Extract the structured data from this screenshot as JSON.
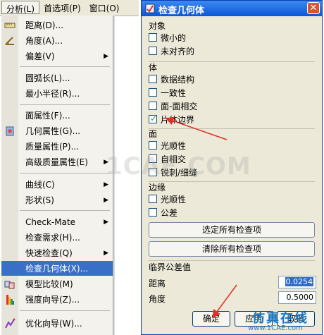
{
  "menubar": {
    "items": [
      {
        "label": "分析(L)",
        "active": true
      },
      {
        "label": "首选项(P)"
      },
      {
        "label": "窗口(O)"
      }
    ]
  },
  "menu": {
    "items": [
      {
        "label": "距离(D)...",
        "icon": "ruler-icon"
      },
      {
        "label": "角度(A)...",
        "icon": "protractor-icon"
      },
      {
        "label": "偏差(V)",
        "submenu": true
      },
      {
        "label": "圆弧长(L)..."
      },
      {
        "label": "最小半径(R)..."
      },
      {
        "label": "面属性(F)..."
      },
      {
        "label": "几何属性(G)...",
        "icon": "geometry-properties-icon"
      },
      {
        "label": "质量属性(P)..."
      },
      {
        "label": "高级质量属性(E)",
        "submenu": true
      },
      {
        "label": "曲线(C)",
        "submenu": true
      },
      {
        "label": "形状(S)",
        "submenu": true
      },
      {
        "label": "Check-Mate",
        "submenu": true
      },
      {
        "label": "检查需求(H)..."
      },
      {
        "label": "快速检查(Q)",
        "submenu": true
      },
      {
        "label": "检查几何体(X)...",
        "highlighted": true
      },
      {
        "label": "模型比较(M)",
        "icon": "model-compare-icon"
      },
      {
        "label": "强度向导(Z)...",
        "icon": "strength-wizard-icon"
      },
      {
        "label": "优化向导(W)...",
        "icon": "optimization-wizard-icon"
      }
    ]
  },
  "dialog": {
    "title": "检查几何体",
    "groups": {
      "objects": "对象",
      "body": "体",
      "face": "面",
      "edge": "边缘",
      "tolerance": "临界公差值"
    },
    "checks": {
      "tiny": {
        "label": "微小的",
        "checked": false
      },
      "misaligned": {
        "label": "未对齐的",
        "checked": false
      },
      "data_structure": {
        "label": "数据结构",
        "checked": false
      },
      "consistency": {
        "label": "一致性",
        "checked": false
      },
      "face_face": {
        "label": "面-面相交",
        "checked": false
      },
      "sheet_boundary": {
        "label": "片体边界",
        "checked": true
      },
      "smoothness": {
        "label": "光顺性",
        "checked": false
      },
      "self_intersect": {
        "label": "自相交",
        "checked": false
      },
      "spikes": {
        "label": "锐刺/细缝",
        "checked": false
      },
      "edge_smoothness": {
        "label": "光顺性",
        "checked": false
      },
      "tolerance": {
        "label": "公差",
        "checked": false
      }
    },
    "select_all": "选定所有检查项",
    "clear_all": "清除所有检查项",
    "distance_label": "距离",
    "distance_value": "0.0254",
    "angle_label": "角度",
    "angle_value": "0.5000",
    "ok": "确定",
    "apply": "应用",
    "cancel": "取消"
  },
  "watermark": "1CAE.COM",
  "logo": {
    "text": "仿真在线",
    "url": "www.1CAE.com"
  },
  "colors": {
    "highlight": "#3a6fc8",
    "titlebar": "#0a56d8",
    "arrow": "#e0302a",
    "check": "#21a121"
  }
}
